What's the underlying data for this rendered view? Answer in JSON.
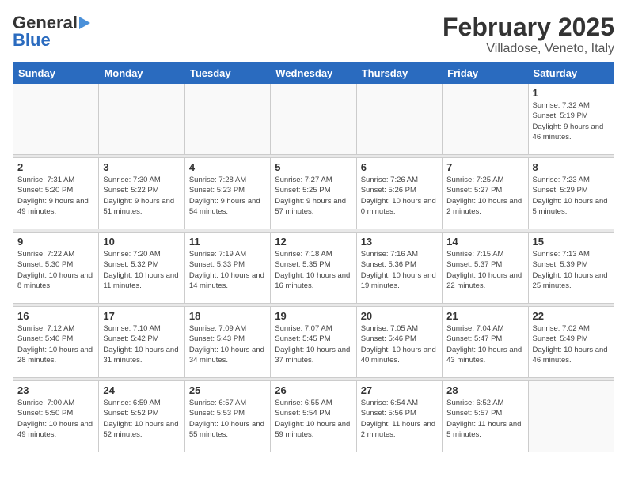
{
  "header": {
    "logo_general": "General",
    "logo_blue": "Blue",
    "title": "February 2025",
    "subtitle": "Villadose, Veneto, Italy"
  },
  "days_of_week": [
    "Sunday",
    "Monday",
    "Tuesday",
    "Wednesday",
    "Thursday",
    "Friday",
    "Saturday"
  ],
  "weeks": [
    [
      {
        "num": "",
        "info": ""
      },
      {
        "num": "",
        "info": ""
      },
      {
        "num": "",
        "info": ""
      },
      {
        "num": "",
        "info": ""
      },
      {
        "num": "",
        "info": ""
      },
      {
        "num": "",
        "info": ""
      },
      {
        "num": "1",
        "info": "Sunrise: 7:32 AM\nSunset: 5:19 PM\nDaylight: 9 hours and 46 minutes."
      }
    ],
    [
      {
        "num": "2",
        "info": "Sunrise: 7:31 AM\nSunset: 5:20 PM\nDaylight: 9 hours and 49 minutes."
      },
      {
        "num": "3",
        "info": "Sunrise: 7:30 AM\nSunset: 5:22 PM\nDaylight: 9 hours and 51 minutes."
      },
      {
        "num": "4",
        "info": "Sunrise: 7:28 AM\nSunset: 5:23 PM\nDaylight: 9 hours and 54 minutes."
      },
      {
        "num": "5",
        "info": "Sunrise: 7:27 AM\nSunset: 5:25 PM\nDaylight: 9 hours and 57 minutes."
      },
      {
        "num": "6",
        "info": "Sunrise: 7:26 AM\nSunset: 5:26 PM\nDaylight: 10 hours and 0 minutes."
      },
      {
        "num": "7",
        "info": "Sunrise: 7:25 AM\nSunset: 5:27 PM\nDaylight: 10 hours and 2 minutes."
      },
      {
        "num": "8",
        "info": "Sunrise: 7:23 AM\nSunset: 5:29 PM\nDaylight: 10 hours and 5 minutes."
      }
    ],
    [
      {
        "num": "9",
        "info": "Sunrise: 7:22 AM\nSunset: 5:30 PM\nDaylight: 10 hours and 8 minutes."
      },
      {
        "num": "10",
        "info": "Sunrise: 7:20 AM\nSunset: 5:32 PM\nDaylight: 10 hours and 11 minutes."
      },
      {
        "num": "11",
        "info": "Sunrise: 7:19 AM\nSunset: 5:33 PM\nDaylight: 10 hours and 14 minutes."
      },
      {
        "num": "12",
        "info": "Sunrise: 7:18 AM\nSunset: 5:35 PM\nDaylight: 10 hours and 16 minutes."
      },
      {
        "num": "13",
        "info": "Sunrise: 7:16 AM\nSunset: 5:36 PM\nDaylight: 10 hours and 19 minutes."
      },
      {
        "num": "14",
        "info": "Sunrise: 7:15 AM\nSunset: 5:37 PM\nDaylight: 10 hours and 22 minutes."
      },
      {
        "num": "15",
        "info": "Sunrise: 7:13 AM\nSunset: 5:39 PM\nDaylight: 10 hours and 25 minutes."
      }
    ],
    [
      {
        "num": "16",
        "info": "Sunrise: 7:12 AM\nSunset: 5:40 PM\nDaylight: 10 hours and 28 minutes."
      },
      {
        "num": "17",
        "info": "Sunrise: 7:10 AM\nSunset: 5:42 PM\nDaylight: 10 hours and 31 minutes."
      },
      {
        "num": "18",
        "info": "Sunrise: 7:09 AM\nSunset: 5:43 PM\nDaylight: 10 hours and 34 minutes."
      },
      {
        "num": "19",
        "info": "Sunrise: 7:07 AM\nSunset: 5:45 PM\nDaylight: 10 hours and 37 minutes."
      },
      {
        "num": "20",
        "info": "Sunrise: 7:05 AM\nSunset: 5:46 PM\nDaylight: 10 hours and 40 minutes."
      },
      {
        "num": "21",
        "info": "Sunrise: 7:04 AM\nSunset: 5:47 PM\nDaylight: 10 hours and 43 minutes."
      },
      {
        "num": "22",
        "info": "Sunrise: 7:02 AM\nSunset: 5:49 PM\nDaylight: 10 hours and 46 minutes."
      }
    ],
    [
      {
        "num": "23",
        "info": "Sunrise: 7:00 AM\nSunset: 5:50 PM\nDaylight: 10 hours and 49 minutes."
      },
      {
        "num": "24",
        "info": "Sunrise: 6:59 AM\nSunset: 5:52 PM\nDaylight: 10 hours and 52 minutes."
      },
      {
        "num": "25",
        "info": "Sunrise: 6:57 AM\nSunset: 5:53 PM\nDaylight: 10 hours and 55 minutes."
      },
      {
        "num": "26",
        "info": "Sunrise: 6:55 AM\nSunset: 5:54 PM\nDaylight: 10 hours and 59 minutes."
      },
      {
        "num": "27",
        "info": "Sunrise: 6:54 AM\nSunset: 5:56 PM\nDaylight: 11 hours and 2 minutes."
      },
      {
        "num": "28",
        "info": "Sunrise: 6:52 AM\nSunset: 5:57 PM\nDaylight: 11 hours and 5 minutes."
      },
      {
        "num": "",
        "info": ""
      }
    ]
  ]
}
